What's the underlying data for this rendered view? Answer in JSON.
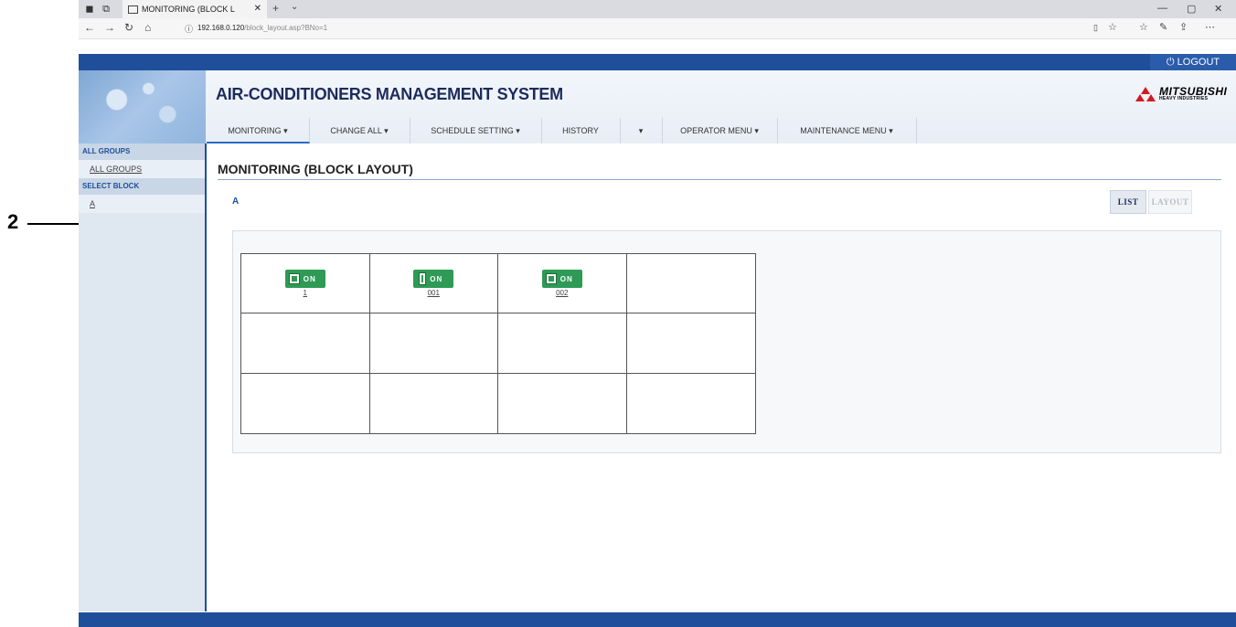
{
  "callout": {
    "number": "2"
  },
  "browser": {
    "tab_title": "MONITORING (BLOCK L",
    "url_host": "192.168.0.120",
    "url_path": "/block_layout.asp?BNo=1"
  },
  "header": {
    "logout_label": "LOGOUT",
    "app_title": "AIR-CONDITIONERS MANAGEMENT SYSTEM",
    "brand_name": "MITSUBISHI",
    "brand_sub": "HEAVY INDUSTRIES"
  },
  "menu": {
    "items": [
      {
        "label": "MONITORING ▾"
      },
      {
        "label": "CHANGE ALL ▾"
      },
      {
        "label": "SCHEDULE SETTING ▾"
      },
      {
        "label": "HISTORY"
      },
      {
        "label": "▾"
      },
      {
        "label": "OPERATOR MENU ▾"
      },
      {
        "label": "MAINTENANCE MENU ▾"
      }
    ]
  },
  "sidebar": {
    "all_groups_heading": "ALL GROUPS",
    "all_groups_link": "ALL GROUPS",
    "select_block_heading": "SELECT BLOCK",
    "block_link": "A"
  },
  "main": {
    "page_title": "MONITORING (BLOCK LAYOUT)",
    "block_name": "A",
    "list_button": "LIST",
    "layout_button": "LAYOUT",
    "units": [
      {
        "state": "ON",
        "label": "1",
        "icon": "ceiling-cassette-icon"
      },
      {
        "state": "ON",
        "label": "001",
        "icon": "wall-unit-icon"
      },
      {
        "state": "ON",
        "label": "002",
        "icon": "floor-unit-icon"
      }
    ]
  },
  "colors": {
    "header_blue": "#1f4f9a",
    "unit_on_green": "#2e9a55",
    "callout_red": "#d8202c"
  }
}
